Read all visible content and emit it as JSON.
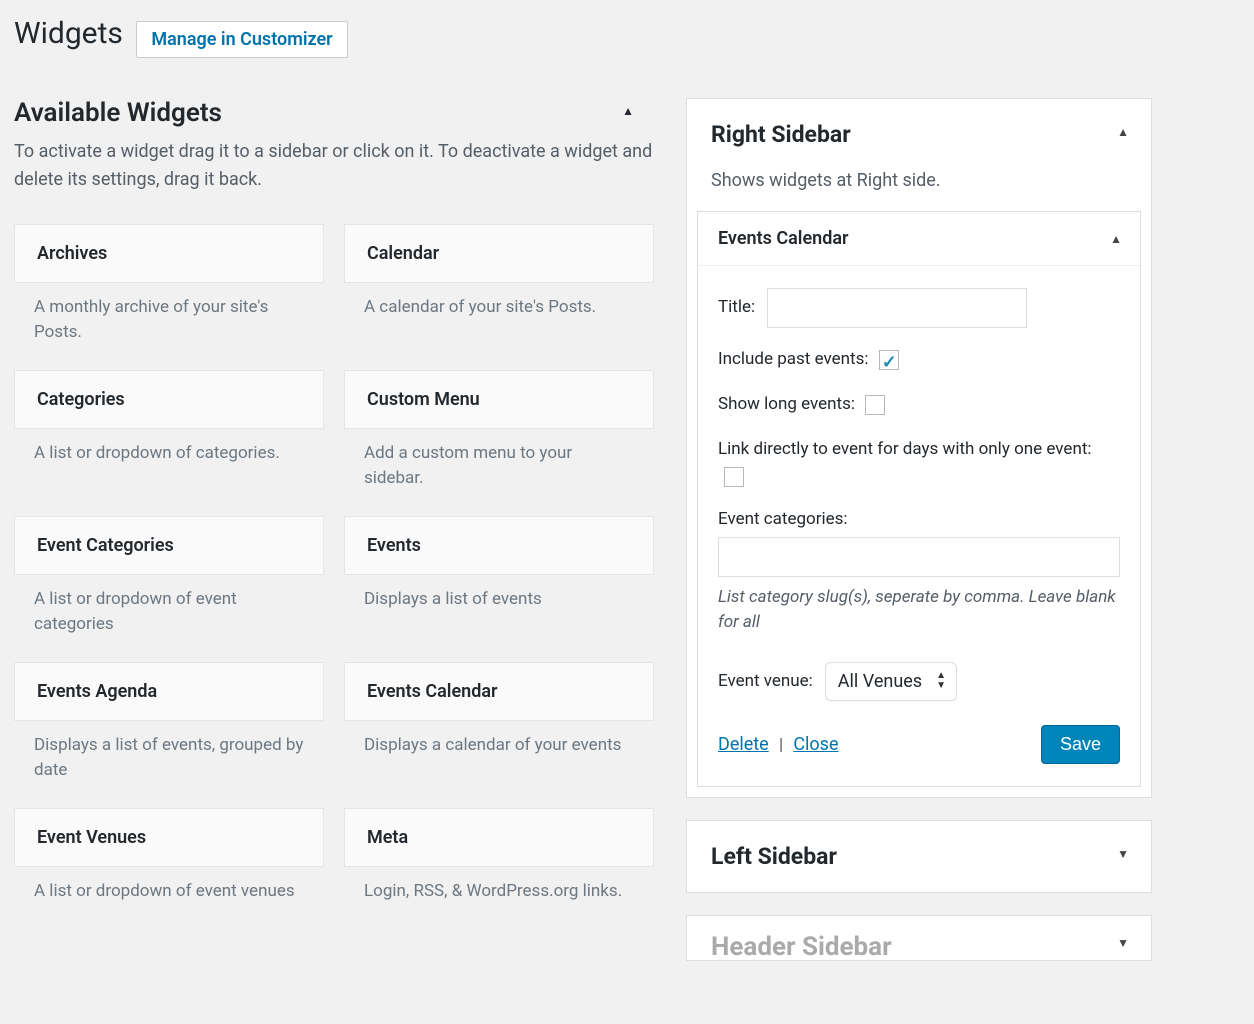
{
  "page": {
    "title": "Widgets",
    "customizer_button": "Manage in Customizer"
  },
  "available": {
    "heading": "Available Widgets",
    "description": "To activate a widget drag it to a sidebar or click on it. To deactivate a widget and delete its settings, drag it back.",
    "widgets": [
      {
        "name": "Archives",
        "desc": "A monthly archive of your site's Posts."
      },
      {
        "name": "Calendar",
        "desc": "A calendar of your site's Posts."
      },
      {
        "name": "Categories",
        "desc": "A list or dropdown of categories."
      },
      {
        "name": "Custom Menu",
        "desc": "Add a custom menu to your sidebar."
      },
      {
        "name": "Event Categories",
        "desc": "A list or dropdown of event categories"
      },
      {
        "name": "Events",
        "desc": "Displays a list of events"
      },
      {
        "name": "Events Agenda",
        "desc": "Displays a list of events, grouped by date"
      },
      {
        "name": "Events Calendar",
        "desc": "Displays a calendar of your events"
      },
      {
        "name": "Event Venues",
        "desc": "A list or dropdown of event venues"
      },
      {
        "name": "Meta",
        "desc": "Login, RSS, & WordPress.org links."
      }
    ]
  },
  "right_sidebar": {
    "title": "Right Sidebar",
    "subtitle": "Shows widgets at Right side.",
    "widget": {
      "title": "Events Calendar",
      "fields": {
        "title_label": "Title:",
        "title_value": "",
        "include_past_label": "Include past events:",
        "include_past_checked": true,
        "show_long_label": "Show long events:",
        "show_long_checked": false,
        "link_direct_label": "Link directly to event for days with only one event:",
        "link_direct_checked": false,
        "categories_label": "Event categories:",
        "categories_value": "",
        "categories_hint": "List category slug(s), seperate by comma. Leave blank for all",
        "venue_label": "Event venue:",
        "venue_value": "All Venues"
      },
      "actions": {
        "delete": "Delete",
        "close": "Close",
        "save": "Save"
      }
    }
  },
  "left_sidebar": {
    "title": "Left Sidebar"
  },
  "header_sidebar": {
    "title": "Header Sidebar"
  }
}
